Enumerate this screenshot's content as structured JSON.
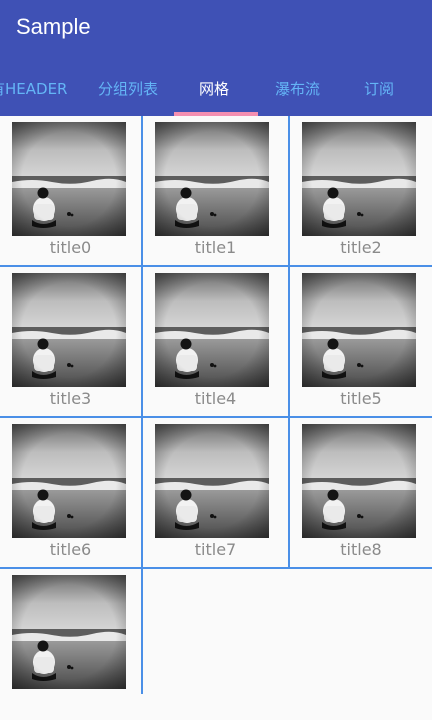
{
  "app": {
    "title": "Sample"
  },
  "tabs": [
    {
      "label": "有HEADER",
      "active": false
    },
    {
      "label": "分组列表",
      "active": false
    },
    {
      "label": "网格",
      "active": true
    },
    {
      "label": "瀑布流",
      "active": false
    },
    {
      "label": "订阅",
      "active": false
    }
  ],
  "colors": {
    "appbar": "#3f51b5",
    "tab_active": "#ffffff",
    "tab_inactive": "#64b5f6",
    "indicator": "#f48fb1",
    "divider": "#4a8fe7"
  },
  "grid": {
    "items": [
      {
        "title": "title0"
      },
      {
        "title": "title1"
      },
      {
        "title": "title2"
      },
      {
        "title": "title3"
      },
      {
        "title": "title4"
      },
      {
        "title": "title5"
      },
      {
        "title": "title6"
      },
      {
        "title": "title7"
      },
      {
        "title": "title8"
      },
      {
        "title": ""
      }
    ]
  }
}
